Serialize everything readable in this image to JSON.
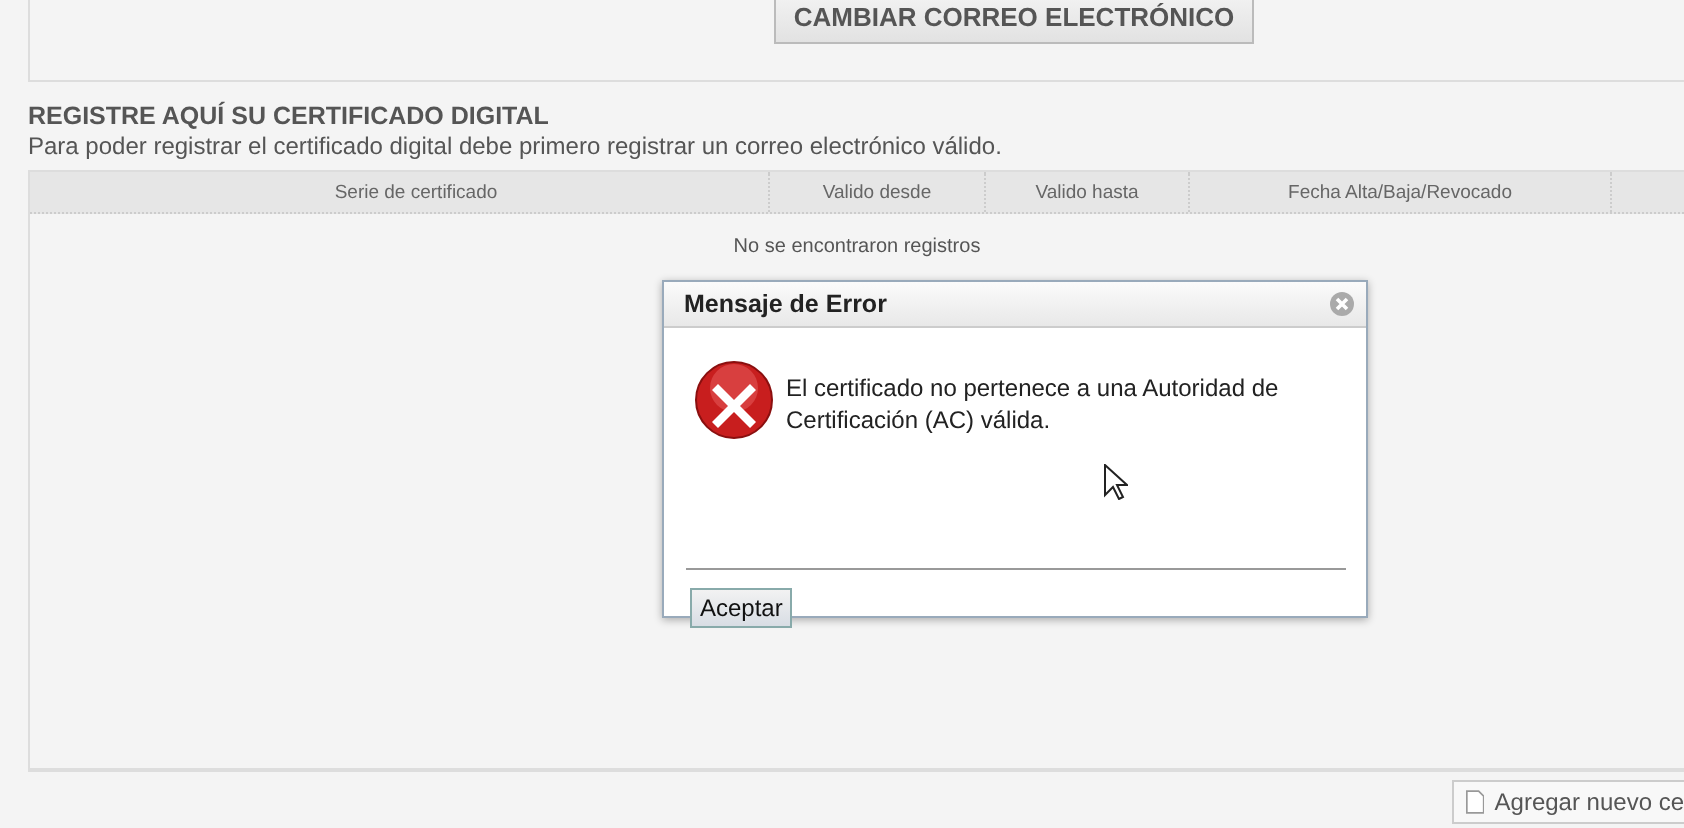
{
  "top_panel": {
    "button": "CAMBIAR CORREO ELECTRÓNICO"
  },
  "section": {
    "title": "REGISTRE AQUÍ SU CERTIFICADO DIGITAL",
    "subtitle": "Para poder registrar el certificado digital debe primero registrar un correo electrónico válido."
  },
  "table": {
    "columns": [
      "Serie de certificado",
      "Valido desde",
      "Valido hasta",
      "Fecha Alta/Baja/Revocado"
    ],
    "empty_message": "No se encontraron registros"
  },
  "toolbar": {
    "button": "Agregar nuevo ce"
  },
  "dialog": {
    "title": "Mensaje de Error",
    "message": "El certificado no pertenece a una Autoridad de Certificación (AC) válida.",
    "button": "Aceptar"
  }
}
